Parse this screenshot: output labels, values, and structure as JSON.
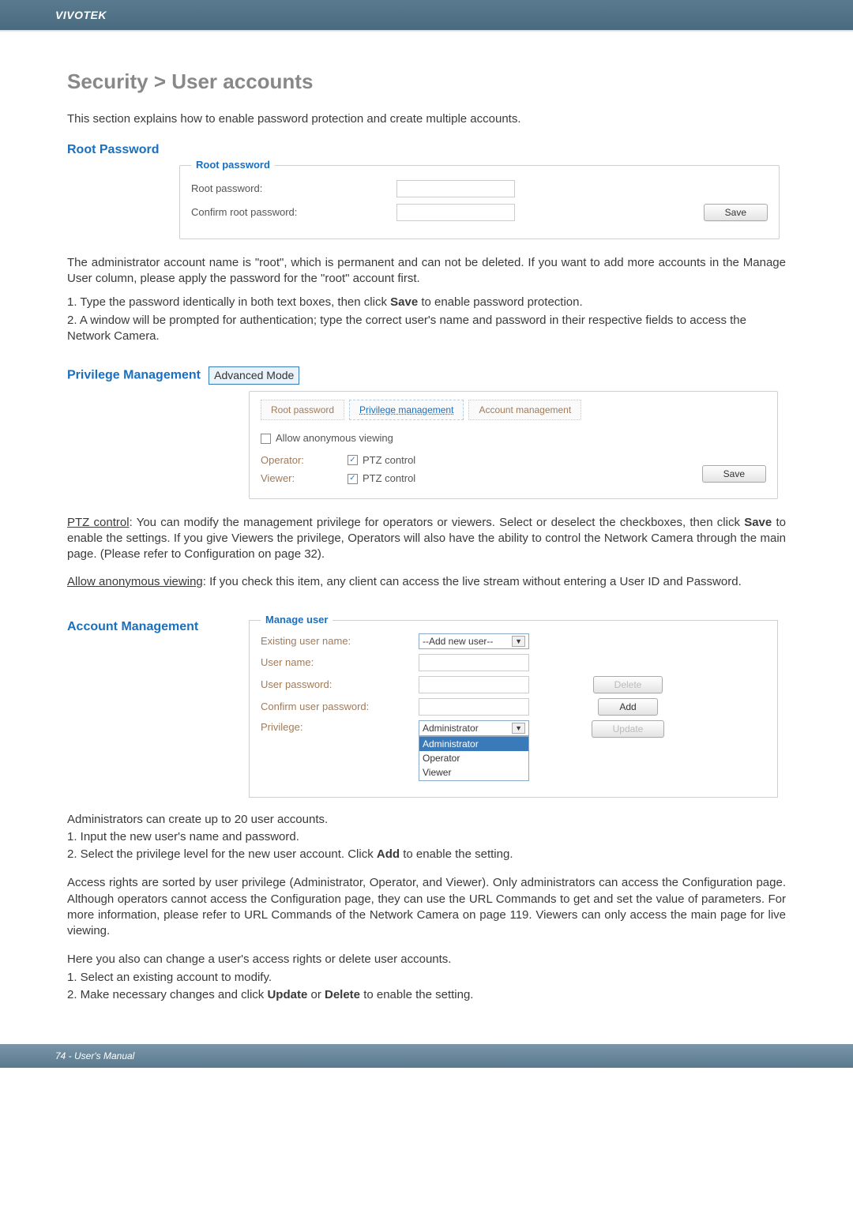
{
  "header": {
    "brand": "VIVOTEK"
  },
  "title": "Security > User accounts",
  "intro": "This section explains how to enable password protection and create multiple accounts.",
  "root_password": {
    "heading": "Root Password",
    "legend": "Root password",
    "labels": {
      "password": "Root password:",
      "confirm": "Confirm root password:"
    },
    "save": "Save"
  },
  "root_desc": "The administrator account name is \"root\", which is permanent and can not be deleted. If you want to add more accounts in the Manage User column, please apply the password for the \"root\" account first.",
  "root_steps": {
    "s1_a": "1. Type the password identically in both text boxes, then click ",
    "s1_bold": "Save",
    "s1_b": " to enable password protection.",
    "s2": "2. A window will be prompted for authentication; type the correct user's name and password in their respective fields to access the Network Camera."
  },
  "priv": {
    "heading": "Privilege Management",
    "badge": "Advanced Mode",
    "tabs": {
      "root": "Root password",
      "priv": "Privilege management",
      "acct": "Account management"
    },
    "allow_anon": "Allow anonymous viewing",
    "operator": "Operator:",
    "viewer": "Viewer:",
    "ptz": "PTZ control",
    "save": "Save"
  },
  "priv_desc": {
    "ptz_label": "PTZ control",
    "ptz_text_a": ": You can modify the management privilege for operators or viewers. Select or deselect the checkboxes, then click ",
    "ptz_bold": "Save",
    "ptz_text_b": " to enable the settings. If you give Viewers the privilege, Operators will also have the ability to control the Network Camera through the main page. (Please refer to Configuration on page 32).",
    "anon_label": "Allow anonymous viewing",
    "anon_text": ": If you check this item, any client can access the live stream without entering a User ID and Password."
  },
  "acct": {
    "heading": "Account Management",
    "legend": "Manage user",
    "labels": {
      "existing": "Existing user name:",
      "username": "User name:",
      "password": "User password:",
      "confirm": "Confirm user password:",
      "privilege": "Privilege:"
    },
    "existing_value": "--Add new user--",
    "priv_selected": "Administrator",
    "options": [
      "Administrator",
      "Operator",
      "Viewer"
    ],
    "buttons": {
      "delete": "Delete",
      "add": "Add",
      "update": "Update"
    }
  },
  "acct_desc": {
    "line0": "Administrators can create up to 20 user accounts.",
    "line1": "1. Input the new user's name and password.",
    "line2_a": "2. Select the privilege level for the new user account. Click ",
    "line2_bold": "Add",
    "line2_b": " to enable the setting.",
    "para2": "Access rights are sorted by user privilege (Administrator, Operator, and Viewer). Only administrators can access the Configuration page. Although operators cannot access the Configuration page, they can use the URL Commands to get and set the value of parameters. For more information, please refer to URL Commands of the Network Camera on page 119. Viewers can only access the main page for live viewing.",
    "para3": "Here you also can change a user's access rights or delete user accounts.",
    "s1": "1. Select an existing account to modify.",
    "s2_a": "2. Make necessary changes and click ",
    "s2_b1": "Update",
    "s2_mid": " or ",
    "s2_b2": "Delete",
    "s2_c": " to enable the setting."
  },
  "footer": "74 - User's Manual"
}
